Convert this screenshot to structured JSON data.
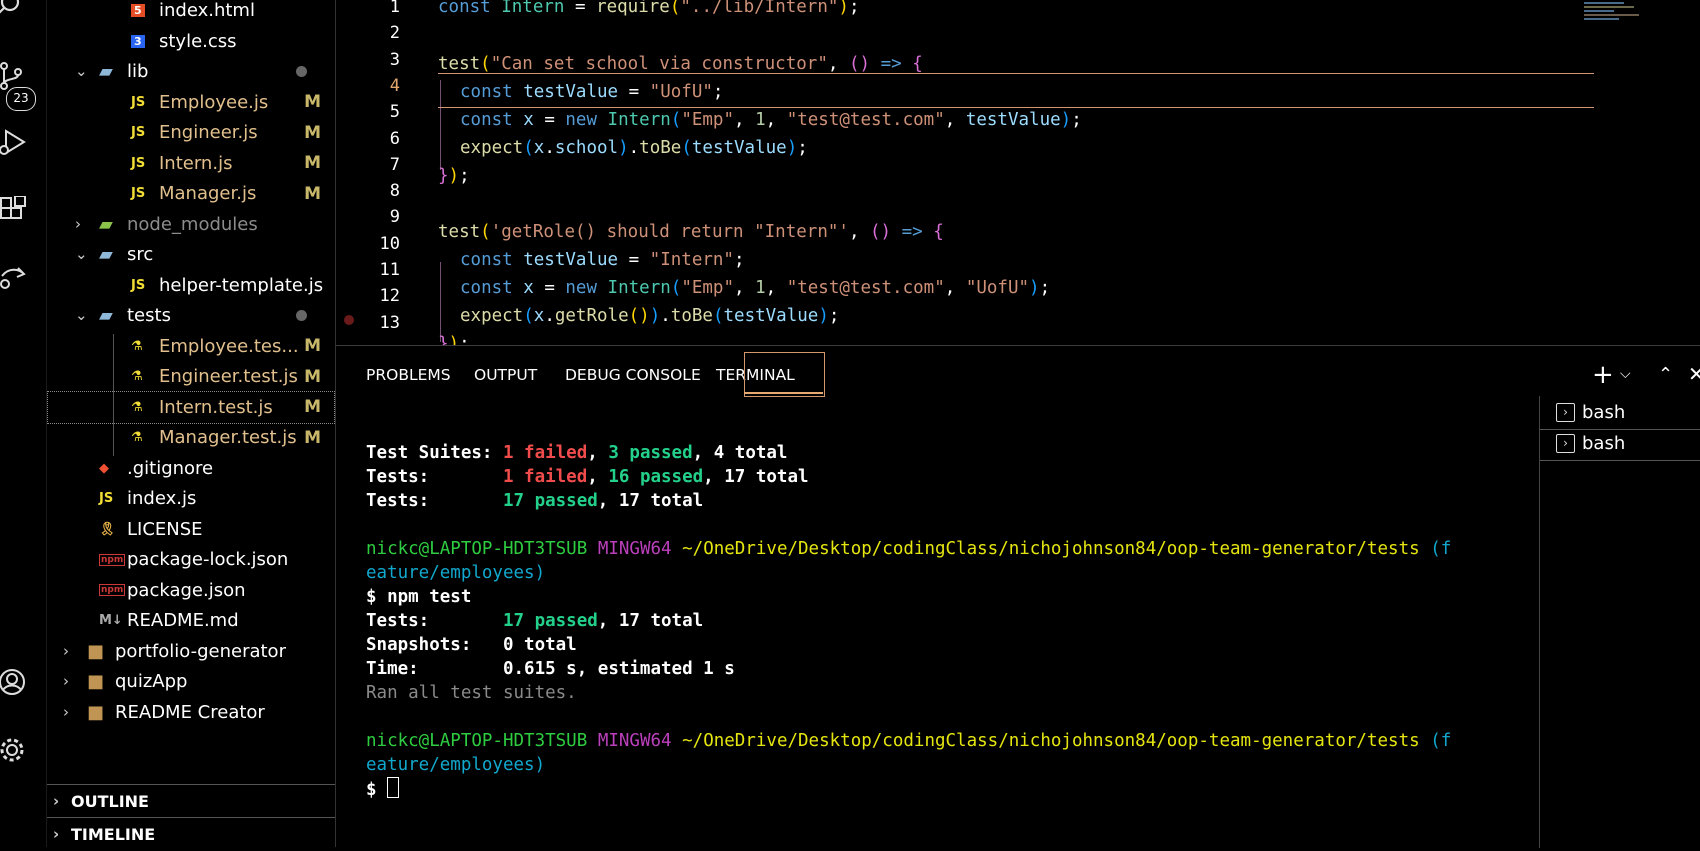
{
  "activity_bar": {
    "scm_badge": "23",
    "icons": [
      "search-icon",
      "source-control-icon",
      "run-debug-icon",
      "extensions-icon",
      "remote-explorer-icon",
      "account-icon",
      "settings-gear-icon"
    ]
  },
  "explorer": {
    "rows": [
      {
        "name": "index.html",
        "type": "html",
        "indent": 2
      },
      {
        "name": "style.css",
        "type": "css",
        "indent": 2
      },
      {
        "name": "lib",
        "type": "folder-open",
        "indent": 1,
        "dot": true
      },
      {
        "name": "Employee.js",
        "type": "js",
        "indent": 2,
        "git": "M"
      },
      {
        "name": "Engineer.js",
        "type": "js",
        "indent": 2,
        "git": "M"
      },
      {
        "name": "Intern.js",
        "type": "js",
        "indent": 2,
        "git": "M"
      },
      {
        "name": "Manager.js",
        "type": "js",
        "indent": 2,
        "git": "M"
      },
      {
        "name": "node_modules",
        "type": "folder-closed",
        "indent": 1
      },
      {
        "name": "src",
        "type": "folder-open",
        "indent": 1
      },
      {
        "name": "helper-template.js",
        "type": "js",
        "indent": 2
      },
      {
        "name": "tests",
        "type": "folder-open",
        "indent": 1,
        "dot": true
      },
      {
        "name": "Employee.tes...",
        "type": "test",
        "indent": 2,
        "git": "M"
      },
      {
        "name": "Engineer.test.js",
        "type": "test",
        "indent": 2,
        "git": "M"
      },
      {
        "name": "Intern.test.js",
        "type": "test",
        "indent": 2,
        "git": "M",
        "selected": true
      },
      {
        "name": "Manager.test.js",
        "type": "test",
        "indent": 2,
        "git": "M"
      },
      {
        "name": ".gitignore",
        "type": "git",
        "indent": 1
      },
      {
        "name": "index.js",
        "type": "js",
        "indent": 1
      },
      {
        "name": "LICENSE",
        "type": "license",
        "indent": 1
      },
      {
        "name": "package-lock.json",
        "type": "npm",
        "indent": 1
      },
      {
        "name": "package.json",
        "type": "npm",
        "indent": 1
      },
      {
        "name": "README.md",
        "type": "md",
        "indent": 1
      },
      {
        "name": "portfolio-generator",
        "type": "folder-root",
        "indent": 0
      },
      {
        "name": "quizApp",
        "type": "folder-root",
        "indent": 0
      },
      {
        "name": "README Creator",
        "type": "folder-root",
        "indent": 0
      }
    ],
    "outline_label": "OUTLINE",
    "timeline_label": "TIMELINE"
  },
  "editor": {
    "line_numbers": [
      "1",
      "2",
      "3",
      "4",
      "5",
      "6",
      "7",
      "8",
      "9",
      "10",
      "11",
      "12",
      "13"
    ],
    "active_line": "4",
    "breakpoint_line": "12"
  },
  "panel": {
    "tabs": [
      "PROBLEMS",
      "OUTPUT",
      "DEBUG CONSOLE",
      "TERMINAL"
    ],
    "active_tab": "TERMINAL",
    "terminals": [
      "bash",
      "bash"
    ],
    "terminal_lines": {
      "l1_label": "Test Suites: ",
      "l1_failed": "1 failed",
      "l1_sep": ", ",
      "l1_passed": "3 passed",
      "l1_total": ", 4 total",
      "l2_label": "Tests:       ",
      "l2_failed": "1 failed",
      "l2_sep": ", ",
      "l2_passed": "16 passed",
      "l2_total": ", 17 total",
      "l3_label": "Tests:       ",
      "l3_passed": "17 passed",
      "l3_total": ", 17 total",
      "p1_user": "nickc@LAPTOP-HDT3TSUB",
      "p1_env": "MINGW64",
      "p1_path": "~/OneDrive/Desktop/codingClass/nichojohnson84/oop-team-generator/tests",
      "p1_branch_a": "(f",
      "p1_branch_b": "eature/employees)",
      "cmd": "$ npm test",
      "r1_label": "Tests:       ",
      "r1_passed": "17 passed",
      "r1_total": ", 17 total",
      "r2": "Snapshots:   0 total",
      "r3": "Time:        0.615 s, estimated 1 s",
      "r4": "Ran all test suites.",
      "p2_user": "nickc@LAPTOP-HDT3TSUB",
      "p2_env": "MINGW64",
      "p2_path": "~/OneDrive/Desktop/codingClass/nichojohnson84/oop-team-generator/tests",
      "p2_branch_a": "(f",
      "p2_branch_b": "eature/employees)",
      "prompt": "$ "
    }
  }
}
